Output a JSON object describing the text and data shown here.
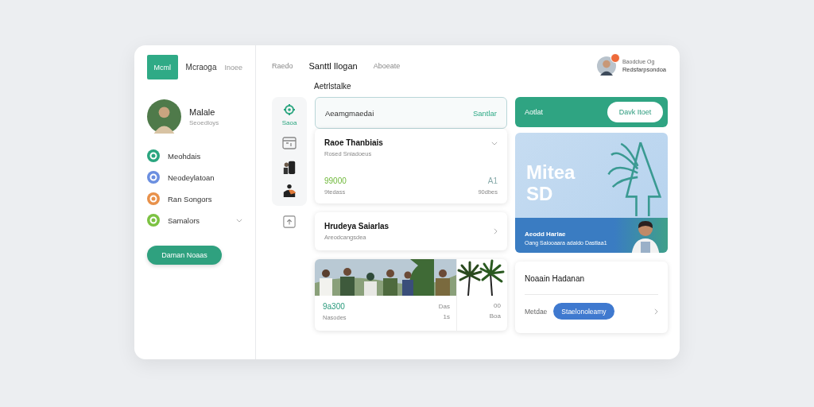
{
  "top_tabs": [
    {
      "label": "Mcml",
      "selected": true
    },
    {
      "label": "Mcraoga",
      "selected": false
    },
    {
      "label": "Inoee",
      "selected": false
    }
  ],
  "profile": {
    "name": "Malale",
    "subtitle": "Seoedloys"
  },
  "nav": [
    {
      "label": "Meohdais",
      "color": "#2aa57f",
      "kind": "link"
    },
    {
      "label": "Neodeylatoan",
      "color": "#6b8fe0",
      "kind": "link"
    },
    {
      "label": "Ran Songors",
      "color": "#e8914a",
      "kind": "link"
    },
    {
      "label": "Samalors",
      "color": "#7cc242",
      "kind": "expandable"
    }
  ],
  "sidebar_button": "Daman Noaas",
  "header_tabs": [
    {
      "label": "Raedo",
      "selected": false
    },
    {
      "label": "Santtl Ilogan",
      "selected": true
    },
    {
      "label": "Aboeate",
      "selected": false
    }
  ],
  "user": {
    "notification": true,
    "line1": "Baodclue Og",
    "line2": "Redsfarpsondoa"
  },
  "section_title": "Aetrlstalke",
  "rail": {
    "label": "Saoa"
  },
  "search": {
    "value": "Aeamgmaedai",
    "button": "Santlar"
  },
  "cards": [
    {
      "kind": "stats",
      "title": "Raoe Thanbiais",
      "subtitle": "Rosed Sniadoeus",
      "value": "99000",
      "value_label": "9tedass",
      "side_value": "A1",
      "side_label": "90dbes"
    },
    {
      "kind": "link",
      "title": "Hrudeya Saiarlas",
      "subtitle": "Areodcangsdea"
    },
    {
      "value": "9a300",
      "value_label": "Nasodes",
      "mid_value": "Das",
      "mid_label": "1s",
      "side_value": "00",
      "side_label": "Boa"
    }
  ],
  "promo": {
    "label": "Aotlat",
    "button": "Davk Itoet"
  },
  "hero": {
    "title": "Mitea",
    "title2": "SD",
    "subtitle": "Aeodd Harlae",
    "text": "Oang Salooaara adaldo Dastlaa1"
  },
  "info": {
    "title": "Noaain Hadanan",
    "label": "Metdae",
    "chip": "Staelonoleamy"
  }
}
